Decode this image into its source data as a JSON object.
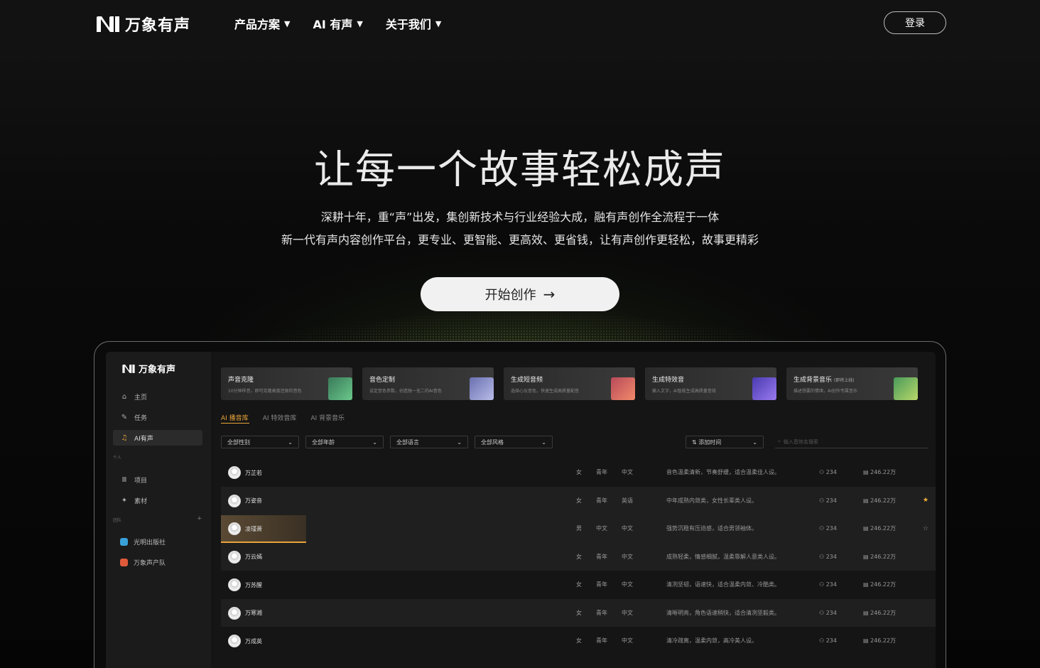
{
  "header": {
    "logo_text": "万象有声",
    "nav": [
      {
        "label": "产品方案"
      },
      {
        "label": "AI 有声"
      },
      {
        "label": "关于我们"
      }
    ],
    "login_label": "登录"
  },
  "hero": {
    "title": "让每一个故事轻松成声",
    "subtitle_line1": "深耕十年，重“声”出发，集创新技术与行业经验大成，融有声创作全流程于一体",
    "subtitle_line2": "新一代有声内容创作平台，更专业、更智能、更高效、更省钱，让有声创作更轻松，故事更精彩",
    "cta_label": "开始创作",
    "cta_icon": "arrow-right-icon"
  },
  "app": {
    "logo_text": "万象有声",
    "sidebar": {
      "items": [
        {
          "label": "主页",
          "icon": "home-icon"
        },
        {
          "label": "任务",
          "icon": "tasks-icon"
        },
        {
          "label": "AI有声",
          "icon": "music-icon",
          "active": true
        }
      ],
      "personal_group": "个人",
      "personal_items": [
        {
          "label": "项目",
          "icon": "library-icon"
        },
        {
          "label": "素材",
          "icon": "assets-icon"
        }
      ],
      "team_group": "团队",
      "team_items": [
        {
          "label": "光明出版社",
          "color": "#3aa0d8"
        },
        {
          "label": "万象声产队",
          "color": "#e05a3a"
        }
      ]
    },
    "cards": [
      {
        "title": "声音克隆",
        "desc": "10分钟样音，即可克隆高度还原的音色",
        "color": "#5fb87a"
      },
      {
        "title": "音色定制",
        "desc": "设定音色参数，创造独一无二的AI音色",
        "color": "#8a90c8"
      },
      {
        "title": "生成短音频",
        "desc": "选择心仪音色，快速生成高质量配音",
        "color": "#d86a5a"
      },
      {
        "title": "生成特效音",
        "desc": "输入文字，AI智能生成高质量音效",
        "color": "#6a5ad8"
      },
      {
        "title": "生成背景音乐",
        "badge": "(即将上线)",
        "desc": "描述想要的情绪，AI创作专属音乐",
        "color": "#6ab86a"
      }
    ],
    "tabs": [
      {
        "label": "AI 播音库",
        "active": true
      },
      {
        "label": "AI 特效音库"
      },
      {
        "label": "AI 背景音乐"
      }
    ],
    "filters": [
      "全部性别",
      "全部年龄",
      "全部语言",
      "全部风格"
    ],
    "sort_label": "添加时间",
    "search_placeholder": "输入音效名搜索",
    "rows": [
      {
        "name": "万芷若",
        "gender": "女",
        "age": "青年",
        "lang": "中文",
        "desc": "音色温柔清新，节奏舒缓，适合温柔佳人设。",
        "likes": "234",
        "plays": "246.22万",
        "star": ""
      },
      {
        "name": "万姿音",
        "gender": "女",
        "age": "青年",
        "lang": "英语",
        "desc": "中年成熟内敛类，女性长辈类人设。",
        "likes": "234",
        "plays": "246.22万",
        "star": "★"
      },
      {
        "name": "凌瑾萧",
        "gender": "男",
        "age": "中文",
        "lang": "中文",
        "desc": "强势沉稳有压迫感，适合男领袖体。",
        "likes": "234",
        "plays": "246.22万",
        "star": "☆"
      },
      {
        "name": "万云嫣",
        "gender": "女",
        "age": "青年",
        "lang": "中文",
        "desc": "成熟轻柔，情感细腻，温柔靠解人意类人设。",
        "likes": "234",
        "plays": "246.22万",
        "star": ""
      },
      {
        "name": "万苏醒",
        "gender": "女",
        "age": "青年",
        "lang": "中文",
        "desc": "清冽坚韧，语速快，适合温柔内敛、冷酷类。",
        "likes": "234",
        "plays": "246.22万",
        "star": ""
      },
      {
        "name": "万寒湘",
        "gender": "女",
        "age": "青年",
        "lang": "中文",
        "desc": "清晰明亮，角色语速稍快，适合清冽坚毅类。",
        "likes": "234",
        "plays": "246.22万",
        "star": ""
      },
      {
        "name": "万成英",
        "gender": "女",
        "age": "青年",
        "lang": "中文",
        "desc": "清冷疏离，温柔内敛，高冷美人设。",
        "likes": "234",
        "plays": "246.22万",
        "star": ""
      }
    ],
    "playing_progress": 1.0
  }
}
